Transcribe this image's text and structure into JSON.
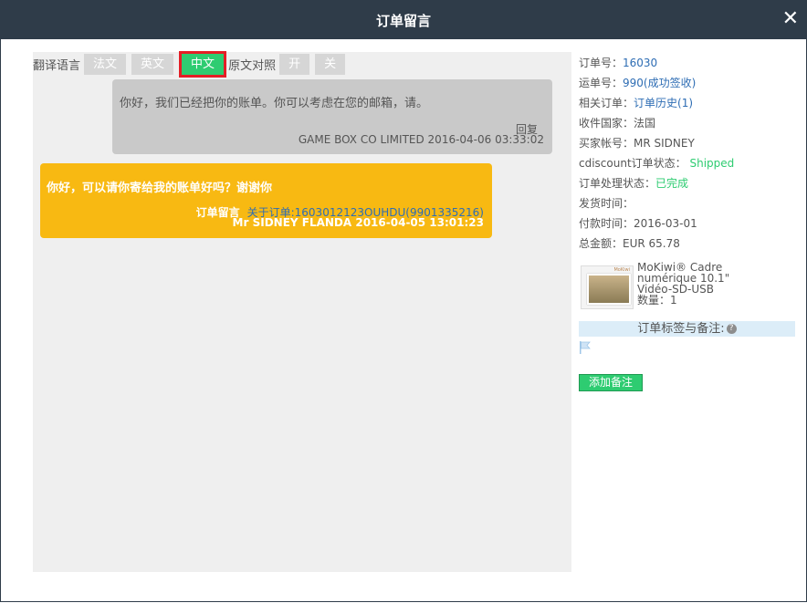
{
  "dialog": {
    "title": "订单留言",
    "close_label": "✕"
  },
  "language_bar": {
    "label": "翻译语言",
    "buttons": [
      "法文",
      "英文",
      "中文"
    ],
    "active": "中文",
    "original_label": "原文对照",
    "toggle_on": "开",
    "toggle_off": "关"
  },
  "messages": [
    {
      "text": "你好，我们已经把你的账单。你可以考虑在您的邮箱，请。",
      "reply_label": "回复",
      "meta": "GAME BOX CO LIMITED  2016-04-06 03:33:02"
    },
    {
      "text": "你好，可以请你寄给我的账单好吗？谢谢你",
      "source_label": "订单留言",
      "order_link": "关于订单:1603012123OUHDU(9901335216)",
      "meta": "Mr SIDNEY FLANDA  2016-04-05 13:01:23"
    }
  ],
  "order_info": {
    "order_no_label": "订单号：",
    "order_no": "16030",
    "tracking_label": "运单号：",
    "tracking_no": "990",
    "tracking_status": "(成功签收)",
    "related_label": "相关订单：",
    "related_link": "订单历史(1)",
    "country_label": "收件国家：",
    "country": "法国",
    "buyer_label": "买家帐号：",
    "buyer": "MR SIDNEY",
    "cd_status_label": "cdiscount订单状态：",
    "cd_status": "Shipped",
    "process_label": "订单处理状态：",
    "process_status": "已完成",
    "ship_time_label": "发货时间：",
    "ship_time": "",
    "pay_time_label": "付款时间：",
    "pay_time": "2016-03-01",
    "total_label": "总金额：",
    "total": "EUR 65.78"
  },
  "product": {
    "brand": "MoKiwi",
    "description": "MoKiwi® Cadre\nnumérique 10.1\"\nVidéo-SD-USB\n数量：1"
  },
  "notes": {
    "header": "订单标签与备注:",
    "help_icon": "?",
    "add_button": "添加备注"
  },
  "colors": {
    "titlebar": "#2f3c49",
    "accent_green": "#2ecc71",
    "message_yellow": "#f8b912",
    "message_gray": "#c9c9c9",
    "link_blue": "#2e6db4",
    "highlight_red": "#e41e26"
  }
}
